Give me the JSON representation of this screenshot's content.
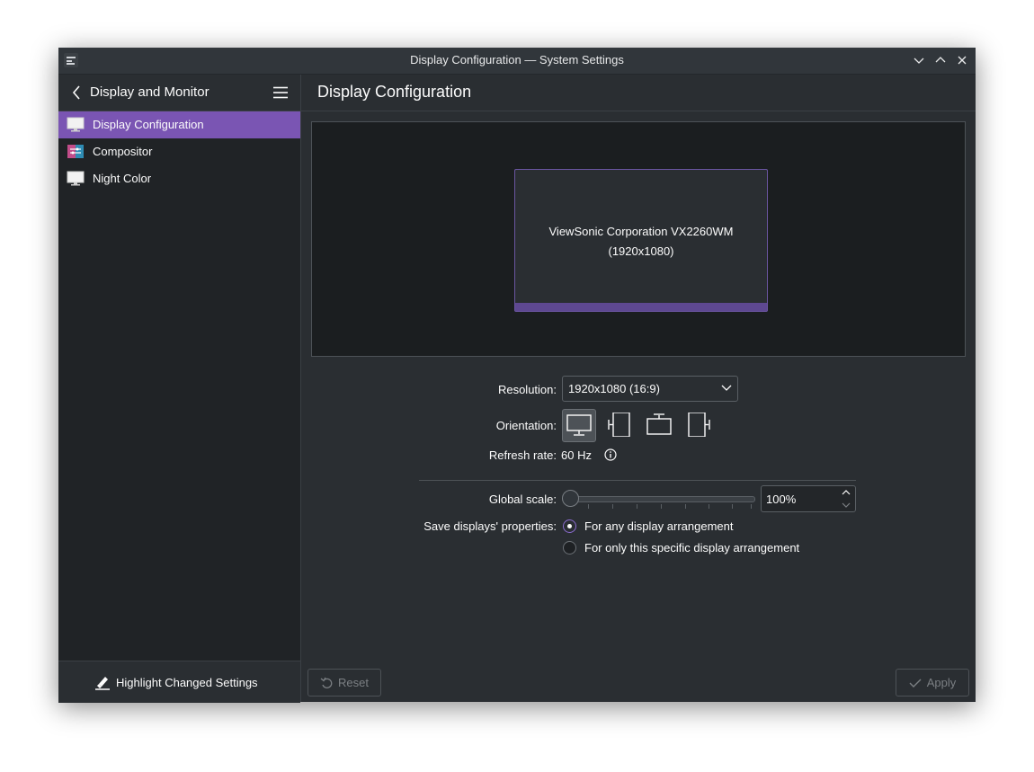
{
  "window": {
    "title": "Display Configuration — System Settings"
  },
  "sidebar": {
    "title": "Display and Monitor",
    "items": [
      {
        "label": "Display Configuration",
        "icon": "monitor-icon",
        "active": true
      },
      {
        "label": "Compositor",
        "icon": "compositor-icon",
        "active": false
      },
      {
        "label": "Night Color",
        "icon": "monitor-icon",
        "active": false
      }
    ],
    "footer_button": "Highlight Changed Settings"
  },
  "main": {
    "title": "Display Configuration",
    "monitor": {
      "name": "ViewSonic Corporation VX2260WM",
      "resolution": "(1920x1080)"
    },
    "resolution": {
      "label": "Resolution:",
      "value": "1920x1080 (16:9)"
    },
    "orientation": {
      "label": "Orientation:",
      "options": [
        "landscape",
        "portrait-left",
        "landscape-flipped",
        "portrait-right"
      ],
      "selected": 0
    },
    "refresh": {
      "label": "Refresh rate:",
      "value": "60 Hz"
    },
    "scale": {
      "label": "Global scale:",
      "value": "100%",
      "slider_fraction": 0.0
    },
    "save_props": {
      "label": "Save displays' properties:",
      "options": [
        "For any display arrangement",
        "For only this specific display arrangement"
      ],
      "selected": 0
    },
    "buttons": {
      "reset": "Reset",
      "apply": "Apply"
    }
  },
  "colors": {
    "accent": "#7a55b3",
    "window_bg": "#2a2e32",
    "sidebar_bg": "#202326",
    "canvas_bg": "#1b1e20"
  }
}
